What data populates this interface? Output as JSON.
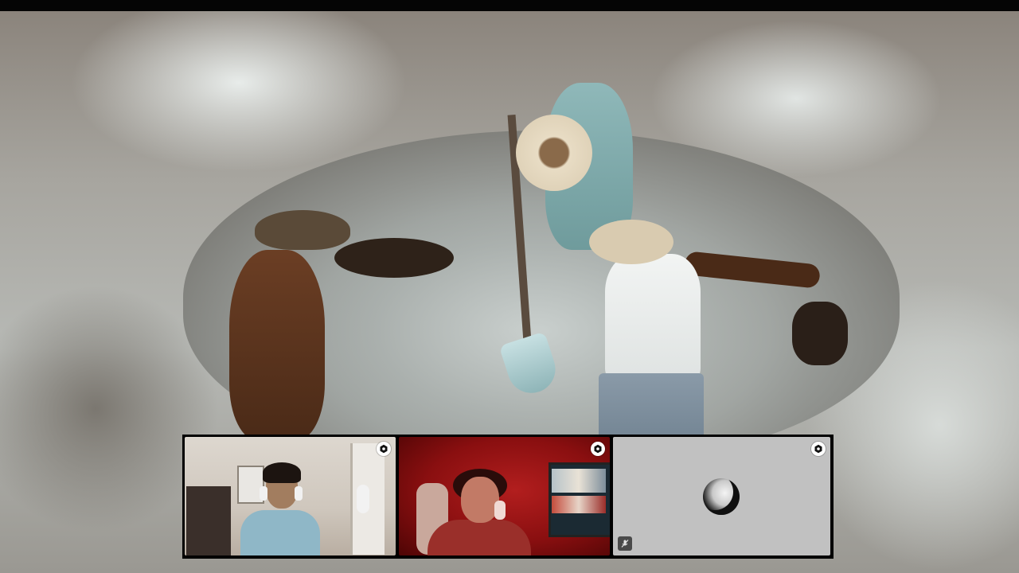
{
  "stream": {
    "scene": "archival-film-digging",
    "accent_color": "#ffffff"
  },
  "call": {
    "participants": [
      {
        "slot": 1,
        "camera": "on",
        "pin_icon": "pin-icon"
      },
      {
        "slot": 2,
        "camera": "on",
        "pin_icon": "pin-icon"
      },
      {
        "slot": 3,
        "camera": "off",
        "pin_icon": "pin-icon",
        "status_icon": "microphone-muted-icon"
      }
    ],
    "colors": {
      "tile_off_bg": "#c1c1c1",
      "badge_bg": "#ffffff",
      "mute_badge_bg": "#4a4a4a"
    }
  }
}
